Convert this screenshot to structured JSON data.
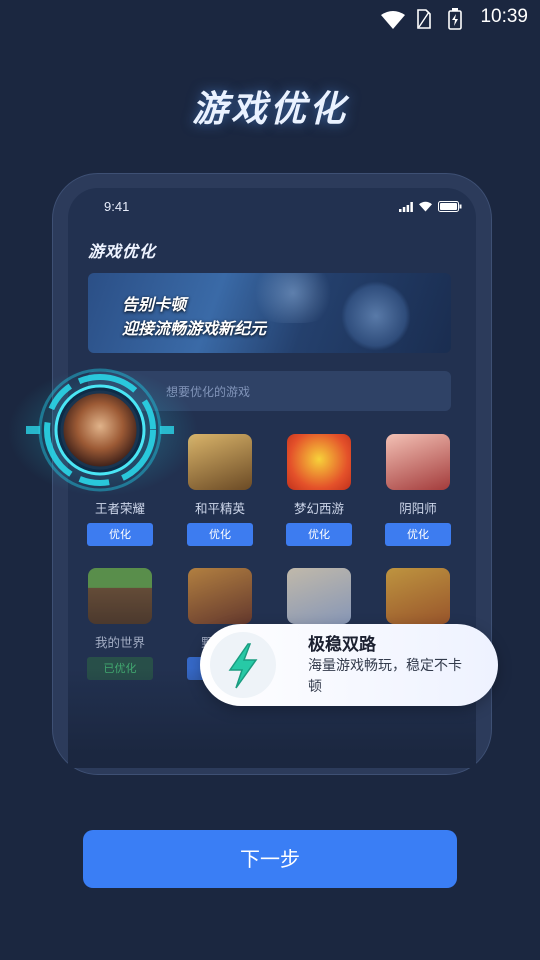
{
  "status_bar": {
    "time": "10:39"
  },
  "hero": {
    "title": "游戏优化"
  },
  "phone": {
    "time": "9:41",
    "header_title": "游戏优化",
    "banner": {
      "line1": "告别卡顿",
      "line2": "迎接流畅游戏新纪元"
    },
    "search": {
      "placeholder": "想要优化的游戏"
    },
    "games_row1": [
      {
        "name": "王者荣耀",
        "button": "优化"
      },
      {
        "name": "和平精英",
        "button": "优化"
      },
      {
        "name": "梦幻西游",
        "button": "优化"
      },
      {
        "name": "阴阳师",
        "button": "优化"
      }
    ],
    "games_row2": [
      {
        "name": "我的世界",
        "button": "已优化"
      },
      {
        "name": "野蛮人",
        "button": ""
      },
      {
        "name": "",
        "button": ""
      },
      {
        "name": "",
        "button": ""
      }
    ]
  },
  "feature": {
    "title": "极稳双路",
    "description": "海量游戏畅玩，稳定不卡顿"
  },
  "next_button": {
    "label": "下一步"
  },
  "colors": {
    "background": "#1b2740",
    "accent": "#3a7ef5",
    "ring": "#2ad6e8",
    "bolt": "#27c9a6"
  }
}
